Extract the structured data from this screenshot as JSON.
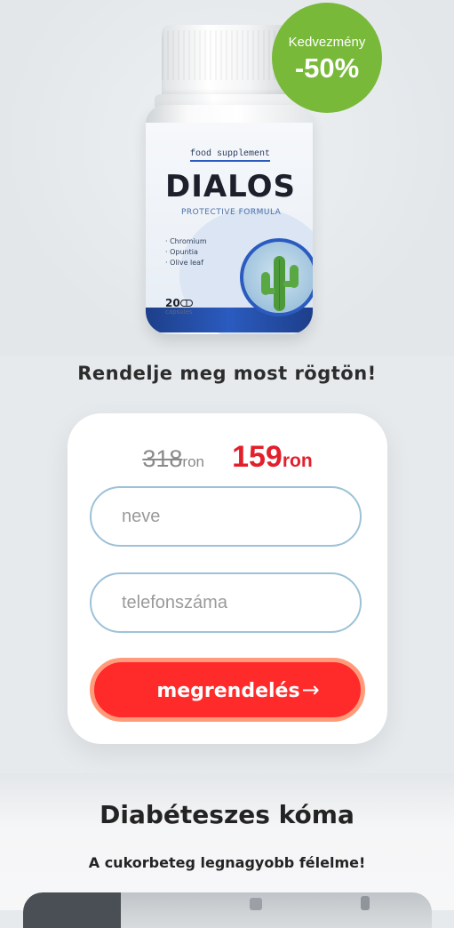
{
  "product": {
    "label_tag": "food supplement",
    "brand": "DIALOS",
    "formula": "PROTECTIVE FORMULA",
    "ingredients": [
      "· Chromium",
      "· Opuntia",
      "· Olive leaf"
    ],
    "capsule_count": "20",
    "capsule_word": "capsules"
  },
  "badge": {
    "label": "Kedvezmény",
    "percent": "-50%",
    "color": "#78b93a"
  },
  "headline": "Rendelje meg most rögtön!",
  "order_form": {
    "old_price": "318",
    "old_currency": "ron",
    "new_price": "159",
    "new_currency": "ron",
    "name_placeholder": "neve",
    "name_value": "",
    "phone_placeholder": "telefonszáma",
    "phone_value": "",
    "submit_label": "megrendelés",
    "submit_arrow": "→",
    "accent_color": "#e2202b"
  },
  "section": {
    "title": "Diabéteszes kóma",
    "subtitle": "A cukorbeteg legnagyobb félelme!"
  }
}
